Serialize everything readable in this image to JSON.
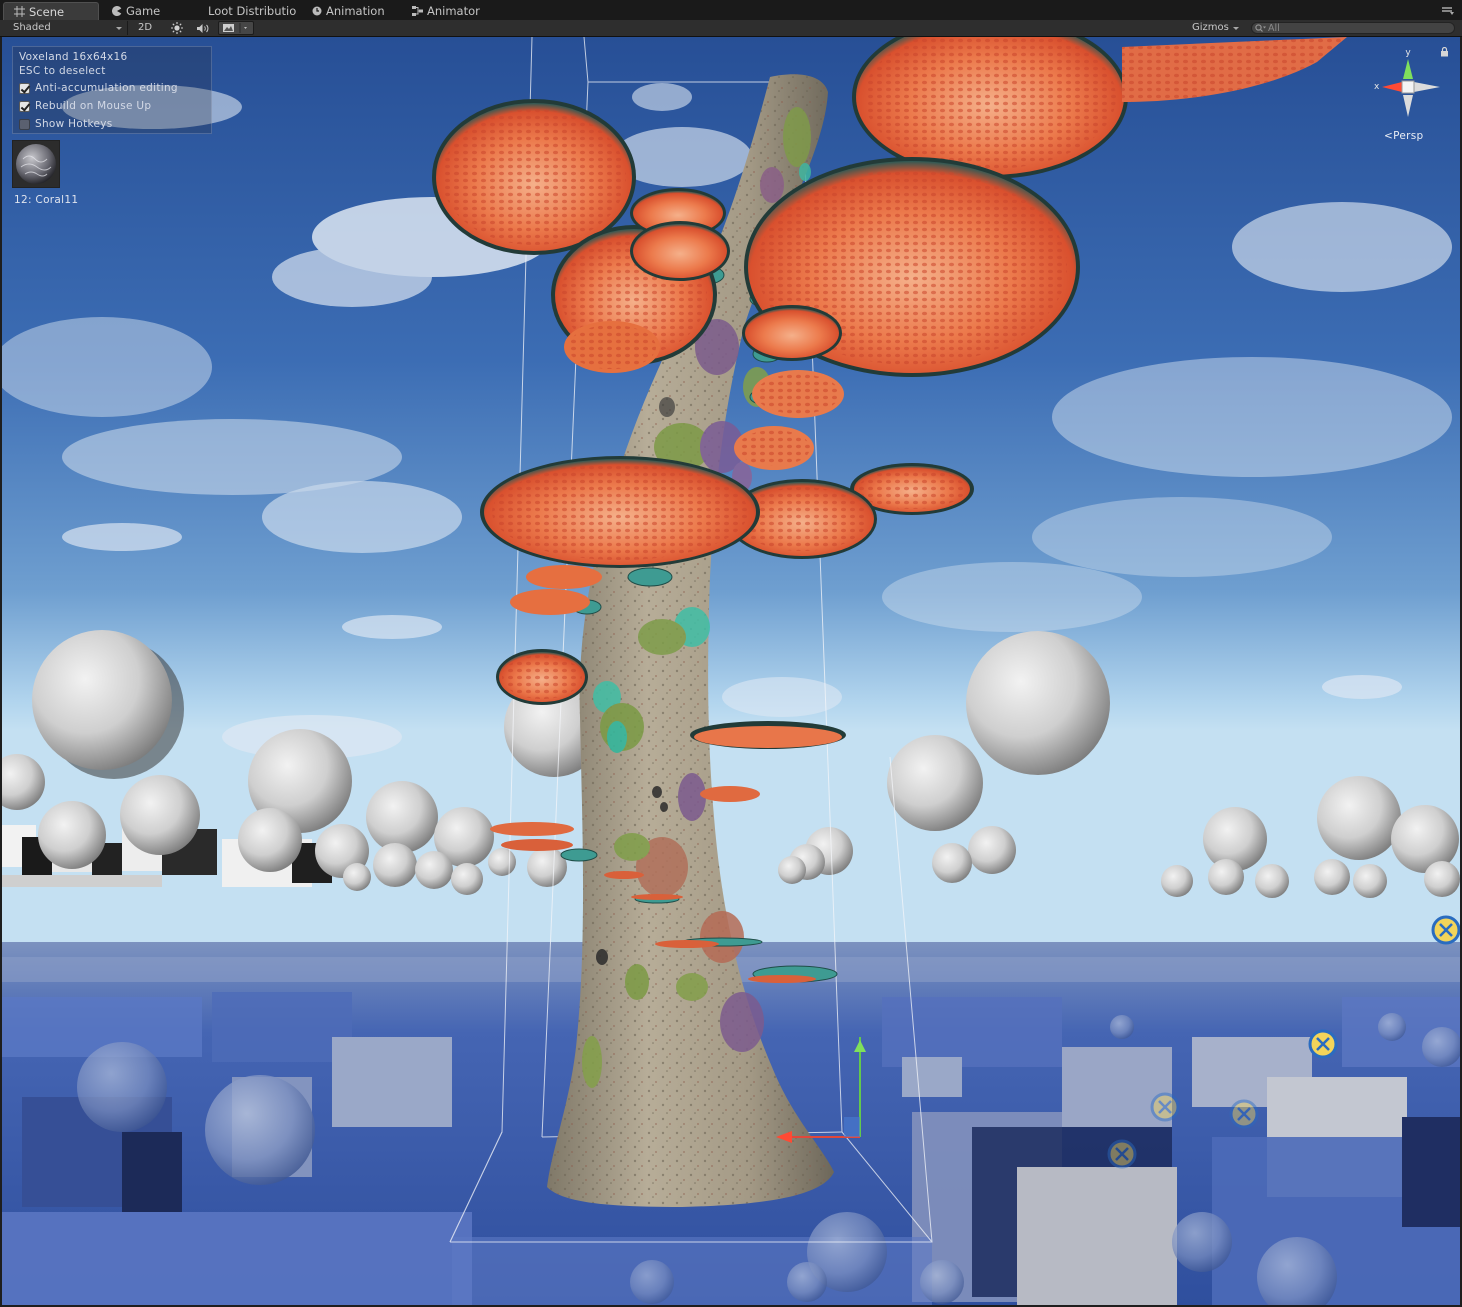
{
  "tabs": [
    {
      "label": "Scene",
      "icon": "scene-grid-icon"
    },
    {
      "label": "Game",
      "icon": "game-pacman-icon"
    },
    {
      "label": "Loot Distributio",
      "icon": ""
    },
    {
      "label": "Animation",
      "icon": "animation-clock-icon"
    },
    {
      "label": "Animator",
      "icon": "animator-nodes-icon"
    }
  ],
  "toolbar": {
    "shading_mode": "Shaded",
    "mode_2d": "2D",
    "gizmos_label": "Gizmos",
    "search_placeholder": "All"
  },
  "overlay": {
    "title": "Voxeland 16x64x16",
    "hint": "ESC to deselect",
    "options": [
      {
        "label": "Anti-accumulation editing",
        "checked": true
      },
      {
        "label": "Rebuild on Mouse Up",
        "checked": true
      },
      {
        "label": "Show Hotkeys",
        "checked": false
      }
    ],
    "selected_block": "12: Coral11"
  },
  "gizmo": {
    "axis_y": "y",
    "axis_x": "x",
    "projection": "Persp"
  },
  "colors": {
    "tab_bg": "#1a1a1a",
    "toolbar_bg": "#2e2e2e",
    "sky_top": "#2f5fa8",
    "sky_horizon": "#a9cfe9",
    "ground_blue": "#3d5fb0",
    "coral_cap": "#e8673c",
    "trunk": "#a59c88"
  }
}
